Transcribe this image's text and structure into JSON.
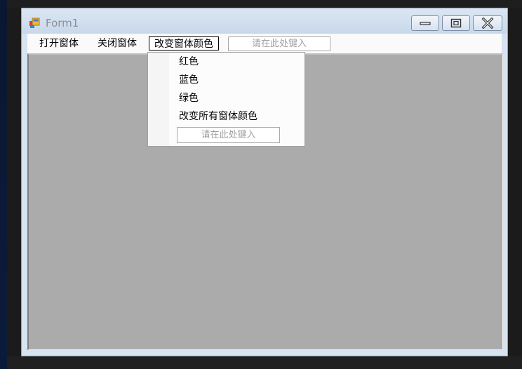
{
  "window": {
    "title": "Form1",
    "controls": {
      "minimize_icon": "minimize-icon",
      "maximize_icon": "maximize-icon",
      "close_icon": "close-icon"
    }
  },
  "menubar": {
    "items": [
      {
        "label": "打开窗体"
      },
      {
        "label": "关闭窗体"
      },
      {
        "label": "改变窗体颜色"
      }
    ],
    "textbox": {
      "placeholder": "请在此处键入"
    }
  },
  "dropdown": {
    "items": [
      {
        "label": "红色"
      },
      {
        "label": "蓝色"
      },
      {
        "label": "绿色"
      },
      {
        "label": "改变所有窗体颜色"
      }
    ],
    "textbox": {
      "placeholder": "请在此处键入"
    }
  },
  "colors": {
    "client_background": "#ababab",
    "window_frame": "#d7e3f0",
    "menubar": "#fafafa"
  }
}
